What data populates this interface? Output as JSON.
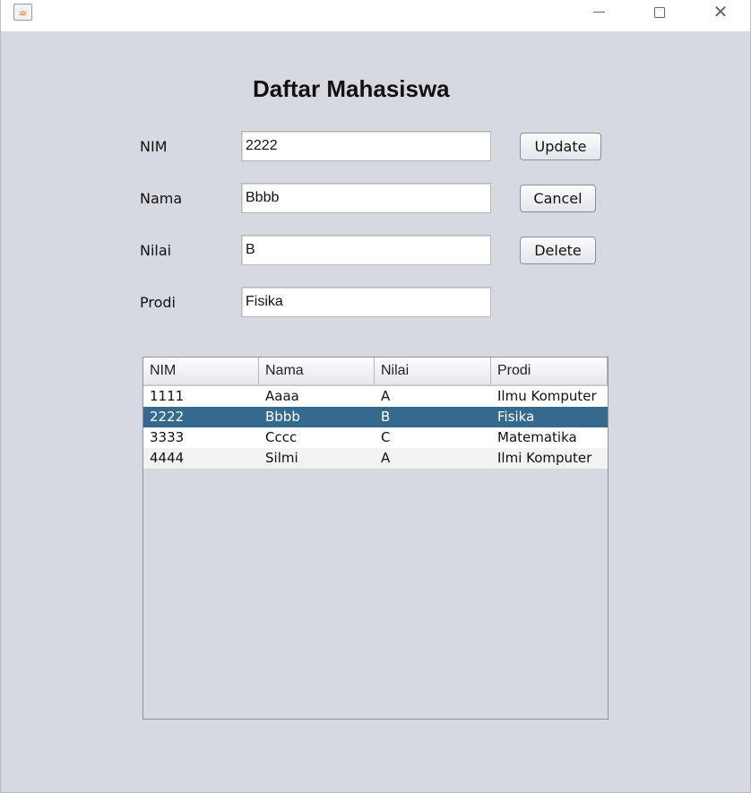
{
  "window": {
    "app_icon": "java-cup-icon",
    "controls": {
      "minimize": "minimize-icon",
      "maximize": "maximize-icon",
      "close": "close-icon"
    }
  },
  "page_title": "Daftar Mahasiswa",
  "form": {
    "nim": {
      "label": "NIM",
      "value": "2222"
    },
    "nama": {
      "label": "Nama",
      "value": "Bbbb"
    },
    "nilai": {
      "label": "Nilai",
      "value": "B"
    },
    "prodi": {
      "label": "Prodi",
      "value": "Fisika"
    }
  },
  "buttons": {
    "update": "Update",
    "cancel": "Cancel",
    "delete": "Delete"
  },
  "table": {
    "columns": [
      "NIM",
      "Nama",
      "Nilai",
      "Prodi"
    ],
    "rows": [
      [
        "1111",
        "Aaaa",
        "A",
        "Ilmu Komputer"
      ],
      [
        "2222",
        "Bbbb",
        "B",
        "Fisika"
      ],
      [
        "3333",
        "Cccc",
        "C",
        "Matematika"
      ],
      [
        "4444",
        "Silmi",
        "A",
        "Ilmi Komputer"
      ]
    ],
    "selected_row": 1,
    "colors": {
      "selection": "#356a8e",
      "window_bg": "#d6d9e0"
    }
  }
}
